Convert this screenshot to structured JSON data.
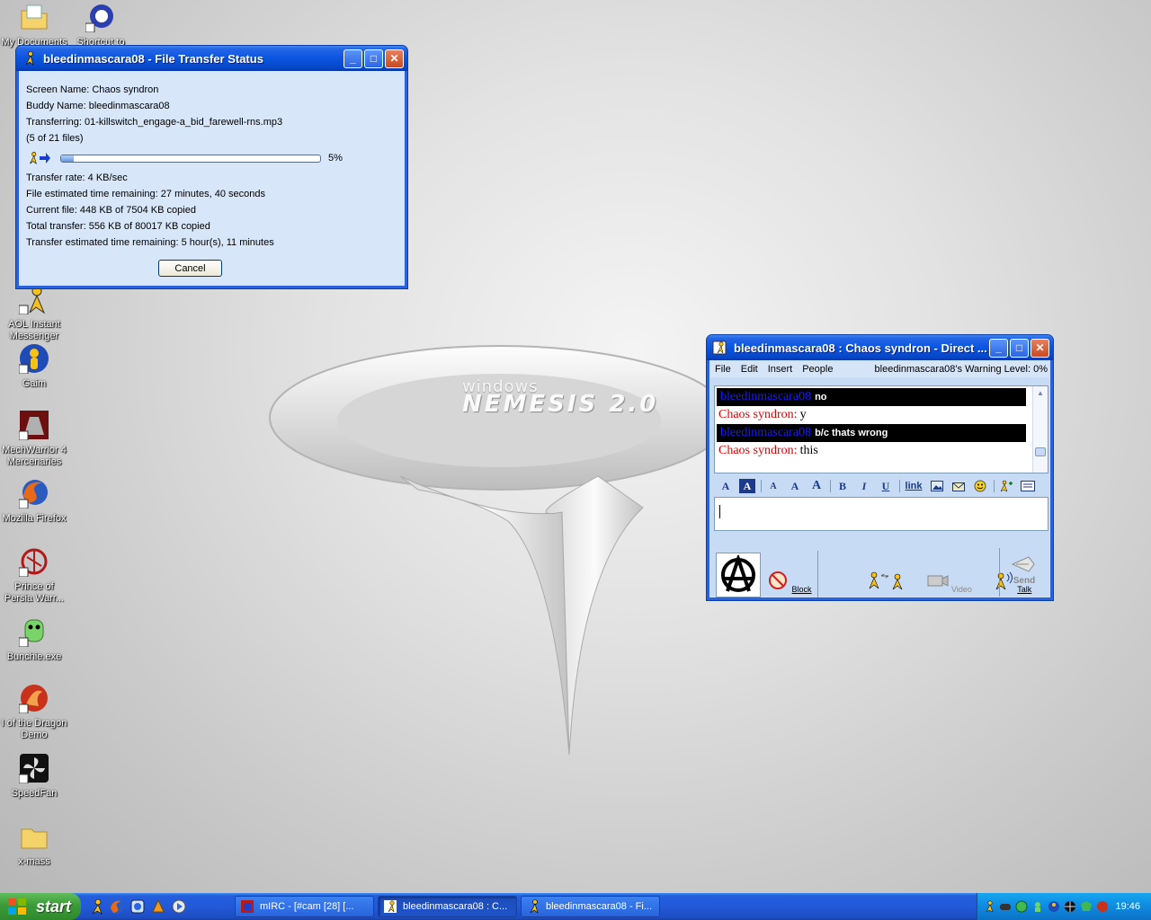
{
  "wallpaper": {
    "line1": "windows",
    "line2": "NEMESIS 2.0"
  },
  "desktop_icons": [
    {
      "label": "My Documents",
      "icon": "folder-documents-icon"
    },
    {
      "label": "Shortcut to",
      "icon": "shortcut-icon"
    },
    {
      "label": "AOL Instant Messenger",
      "icon": "aim-icon"
    },
    {
      "label": "Gaim",
      "icon": "gaim-icon"
    },
    {
      "label": "MechWarrior 4 Mercenaries",
      "icon": "mechwarrior-icon"
    },
    {
      "label": "Mozilla Firefox",
      "icon": "firefox-icon"
    },
    {
      "label": "Prince of Persia Warr...",
      "icon": "prince-of-persia-icon"
    },
    {
      "label": "Bunchie.exe",
      "icon": "bunchie-icon"
    },
    {
      "label": "I of the Dragon Demo",
      "icon": "dragon-icon"
    },
    {
      "label": "SpeedFan",
      "icon": "speedfan-icon"
    },
    {
      "label": "x-mass",
      "icon": "folder-icon"
    }
  ],
  "file_transfer": {
    "title": "bleedinmascara08 - File Transfer Status",
    "screen_name": "Screen Name: Chaos syndron",
    "buddy_name": "Buddy Name: bleedinmascara08",
    "transferring": "Transferring: 01-killswitch_engage-a_bid_farewell-rns.mp3",
    "file_count": "(5 of 21 files)",
    "progress": 0.05,
    "progress_label": "5%",
    "transfer_rate": "Transfer rate: 4 KB/sec",
    "file_eta": "File estimated time remaining: 27 minutes, 40 seconds",
    "current_file": "Current file: 448 KB of 7504 KB copied",
    "total_transfer": "Total transfer: 556 KB of 80017 KB copied",
    "transfer_eta": "Transfer estimated time remaining: 5 hour(s), 11 minutes",
    "cancel_label": "Cancel"
  },
  "im_window": {
    "title": "bleedinmascara08 : Chaos syndron - Direct ...",
    "menu": [
      "File",
      "Edit",
      "Insert",
      "People"
    ],
    "warning_level": "bleedinmascara08's Warning Level: 0%",
    "messages": [
      {
        "sender": "bleedinmascara08",
        "text": "no",
        "side": "them"
      },
      {
        "sender": "Chaos syndron:",
        "text": "y",
        "side": "me"
      },
      {
        "sender": "bleedinmascara08",
        "text": "b/c thats wrong",
        "side": "them"
      },
      {
        "sender": "Chaos syndron:",
        "text": "this",
        "side": "me"
      }
    ],
    "format_buttons": {
      "bold": "B",
      "italic": "I",
      "underline": "U",
      "link": "link",
      "text_color": "A",
      "bg_color": "A",
      "shrink_font": "A",
      "normal_font": "A",
      "grow_font": "A"
    },
    "input_value": "",
    "buttons": {
      "block": "Block",
      "video": "Video",
      "talk": "Talk",
      "send": "Send"
    }
  },
  "taskbar": {
    "start_label": "start",
    "tasks": [
      {
        "label": "mIRC - [#cam [28] [..."
      },
      {
        "label": "bleedinmascara08 : C..."
      },
      {
        "label": "bleedinmascara08 - Fi..."
      }
    ],
    "clock": "19:46"
  },
  "colors": {
    "xp_title_blue": "#0a55e0",
    "window_body": "#d7e6f8",
    "them_name": "#1a1aff",
    "me_name": "#e00000",
    "start_green": "#3c9b38",
    "tray_blue": "#0f8ae0"
  }
}
